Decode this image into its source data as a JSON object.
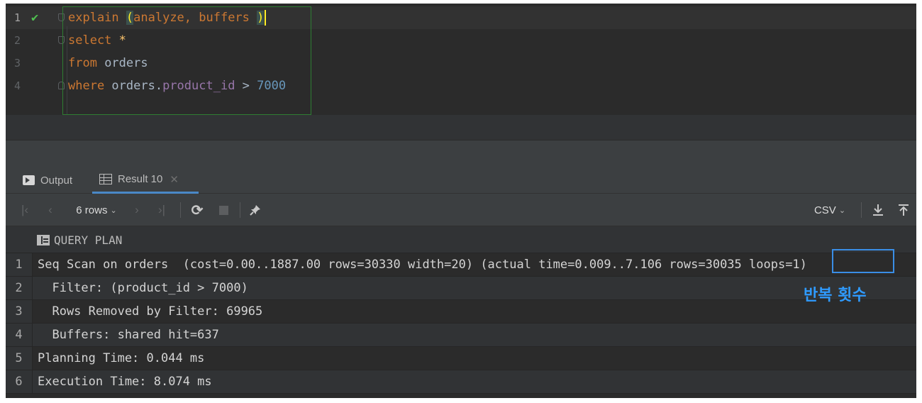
{
  "editor": {
    "lines": [
      {
        "num": "1",
        "parts": [
          {
            "t": "explain ",
            "c": "kw"
          },
          {
            "t": "(",
            "c": "paren-hl"
          },
          {
            "t": "analyze, buffers ",
            "c": "kw"
          },
          {
            "t": ")",
            "c": "paren-hl"
          }
        ]
      },
      {
        "num": "2",
        "parts": [
          {
            "t": "select ",
            "c": "kw"
          },
          {
            "t": "*",
            "c": "kw"
          }
        ]
      },
      {
        "num": "3",
        "parts": [
          {
            "t": "from ",
            "c": "kw"
          },
          {
            "t": "orders",
            "c": "plain"
          }
        ]
      },
      {
        "num": "4",
        "parts": [
          {
            "t": "where ",
            "c": "kw"
          },
          {
            "t": "orders.",
            "c": "plain"
          },
          {
            "t": "product_id",
            "c": "fld"
          },
          {
            "t": " > ",
            "c": "plain"
          },
          {
            "t": "7000",
            "c": "num"
          }
        ]
      }
    ]
  },
  "tabs": {
    "output_label": "Output",
    "result_label": "Result 10"
  },
  "toolbar": {
    "rows_label": "6 rows",
    "export_format": "CSV"
  },
  "grid": {
    "column_header": "QUERY PLAN",
    "rows": [
      {
        "num": "1",
        "text": "Seq Scan on orders  (cost=0.00..1887.00 rows=30330 width=20) (actual time=0.009..7.106 rows=30035 loops=1)"
      },
      {
        "num": "2",
        "text": "  Filter: (product_id > 7000)"
      },
      {
        "num": "3",
        "text": "  Rows Removed by Filter: 69965"
      },
      {
        "num": "4",
        "text": "  Buffers: shared hit=637"
      },
      {
        "num": "5",
        "text": "Planning Time: 0.044 ms"
      },
      {
        "num": "6",
        "text": "Execution Time: 8.074 ms"
      }
    ]
  },
  "annotation": {
    "label": "반복 횟수",
    "highlight_text": "loops=1",
    "color": "#2f9bff"
  },
  "colors": {
    "keyword": "#cc7832",
    "field": "#9876aa",
    "number": "#6897bb",
    "success_check": "#4fbf50",
    "accent": "#4a88c7"
  }
}
